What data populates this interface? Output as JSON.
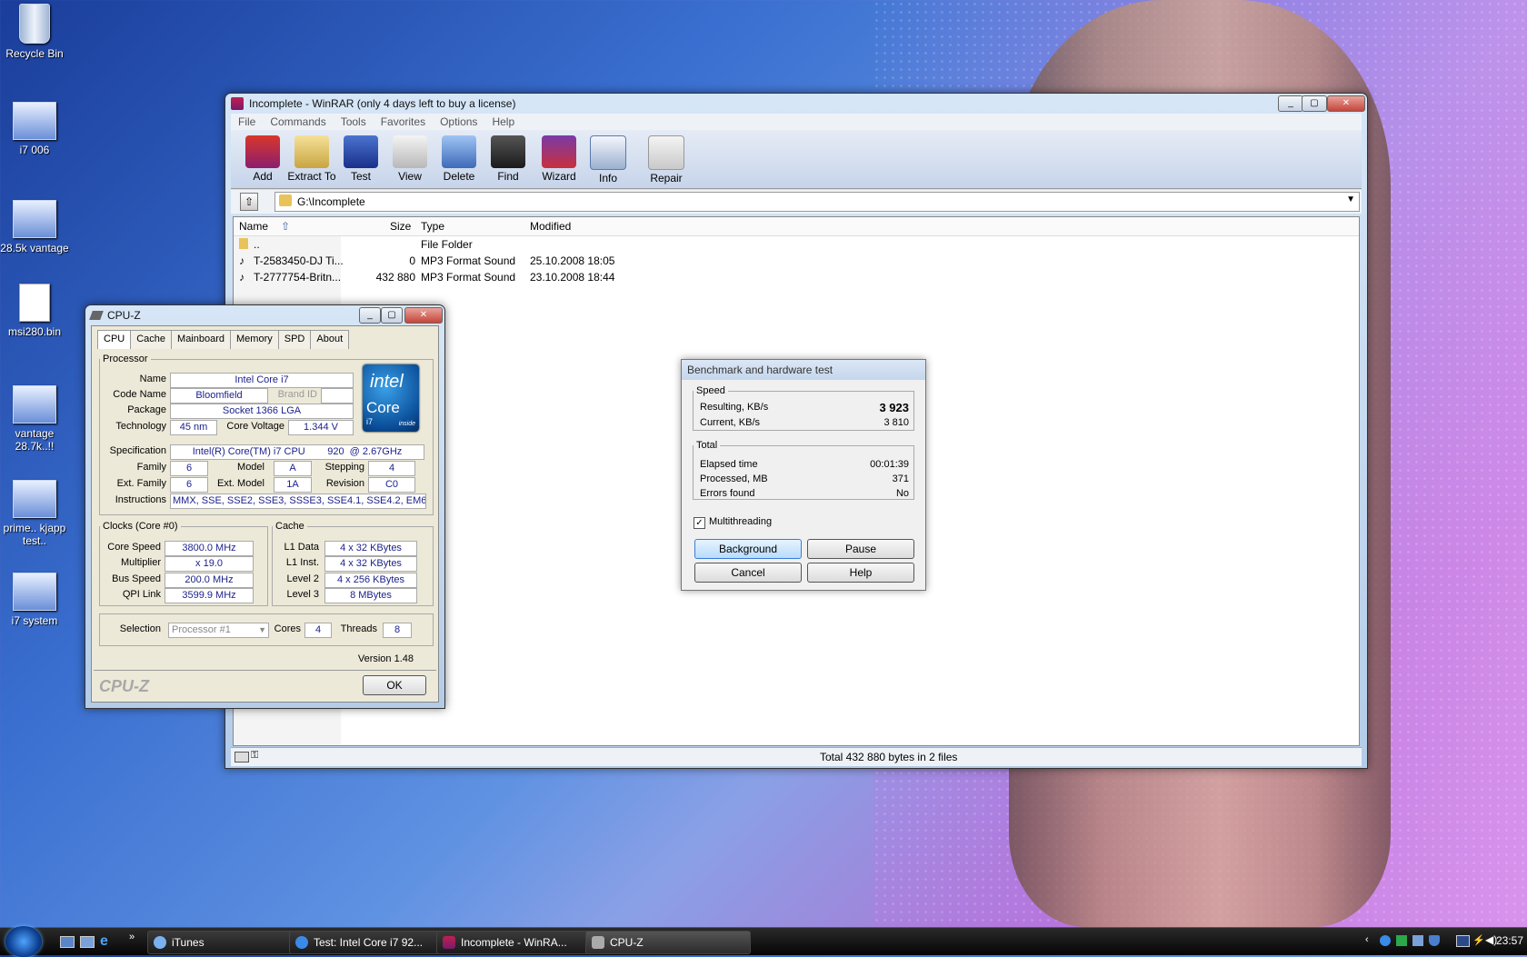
{
  "desktop": {
    "icons": [
      {
        "label": "Recycle Bin"
      },
      {
        "label": "i7 006"
      },
      {
        "label": "28.5k vantage"
      },
      {
        "label": "msi280.bin"
      },
      {
        "label": "vantage 28.7k..!!"
      },
      {
        "label": "prime.. kjapp test.."
      },
      {
        "label": "i7 system"
      }
    ]
  },
  "winrar": {
    "title": "Incomplete - WinRAR (only 4 days left to buy a license)",
    "menu": [
      "File",
      "Commands",
      "Tools",
      "Favorites",
      "Options",
      "Help"
    ],
    "toolbar": [
      "Add",
      "Extract To",
      "Test",
      "View",
      "Delete",
      "Find",
      "Wizard",
      "Info",
      "Repair"
    ],
    "path": "G:\\Incomplete",
    "columns": {
      "name": "Name",
      "size": "Size",
      "type": "Type",
      "modified": "Modified"
    },
    "rows": [
      {
        "name": "..",
        "size": "",
        "type": "File Folder",
        "modified": ""
      },
      {
        "name": "T-2583450-DJ Ti...",
        "size": "0",
        "type": "MP3 Format Sound",
        "modified": "25.10.2008 18:05"
      },
      {
        "name": "T-2777754-Britn...",
        "size": "432 880",
        "type": "MP3 Format Sound",
        "modified": "23.10.2008 18:44"
      }
    ],
    "status": "Total 432 880 bytes in 2 files"
  },
  "cpuz": {
    "title": "CPU-Z",
    "tabs": [
      "CPU",
      "Cache",
      "Mainboard",
      "Memory",
      "SPD",
      "About"
    ],
    "processor": {
      "legend": "Processor",
      "name_label": "Name",
      "name": "Intel Core i7",
      "codename_label": "Code Name",
      "codename": "Bloomfield",
      "brandid_label": "Brand ID",
      "package_label": "Package",
      "package": "Socket 1366 LGA",
      "technology_label": "Technology",
      "technology": "45 nm",
      "voltage_label": "Core Voltage",
      "voltage": "1.344 V",
      "spec_label": "Specification",
      "spec": "Intel(R) Core(TM) i7 CPU        920  @ 2.67GHz",
      "family_label": "Family",
      "family": "6",
      "model_label": "Model",
      "model": "A",
      "stepping_label": "Stepping",
      "stepping": "4",
      "extfamily_label": "Ext. Family",
      "extfamily": "6",
      "extmodel_label": "Ext. Model",
      "extmodel": "1A",
      "revision_label": "Revision",
      "revision": "C0",
      "instructions_label": "Instructions",
      "instructions": "MMX, SSE, SSE2, SSE3, SSSE3, SSE4.1, SSE4.2, EM64T"
    },
    "logo": {
      "brand": "intel",
      "product": "Core",
      "model": "i7",
      "tag": "inside"
    },
    "clocks": {
      "legend": "Clocks (Core #0)",
      "corespeed_label": "Core Speed",
      "corespeed": "3800.0 MHz",
      "multiplier_label": "Multiplier",
      "multiplier": "x 19.0",
      "busspeed_label": "Bus Speed",
      "busspeed": "200.0 MHz",
      "qpi_label": "QPI Link",
      "qpi": "3599.9 MHz"
    },
    "cache": {
      "legend": "Cache",
      "l1d_label": "L1 Data",
      "l1d": "4 x 32 KBytes",
      "l1i_label": "L1 Inst.",
      "l1i": "4 x 32 KBytes",
      "l2_label": "Level 2",
      "l2": "4 x 256 KBytes",
      "l3_label": "Level 3",
      "l3": "8 MBytes"
    },
    "selection_label": "Selection",
    "selection": "Processor #1",
    "cores_label": "Cores",
    "cores": "4",
    "threads_label": "Threads",
    "threads": "8",
    "version": "Version 1.48",
    "brand": "CPU-Z",
    "ok": "OK"
  },
  "benchmark": {
    "title": "Benchmark and hardware test",
    "speed_legend": "Speed",
    "resulting_label": "Resulting, KB/s",
    "resulting": "3 923",
    "current_label": "Current, KB/s",
    "current": "3 810",
    "total_legend": "Total",
    "elapsed_label": "Elapsed time",
    "elapsed": "00:01:39",
    "processed_label": "Processed, MB",
    "processed": "371",
    "errors_label": "Errors found",
    "errors": "No",
    "multithreading": "Multithreading",
    "buttons": {
      "background": "Background",
      "pause": "Pause",
      "cancel": "Cancel",
      "help": "Help"
    }
  },
  "taskbar": {
    "buttons": [
      "iTunes",
      "Test: Intel Core i7 92...",
      "Incomplete - WinRA...",
      "CPU-Z"
    ],
    "clock": "23:57"
  }
}
